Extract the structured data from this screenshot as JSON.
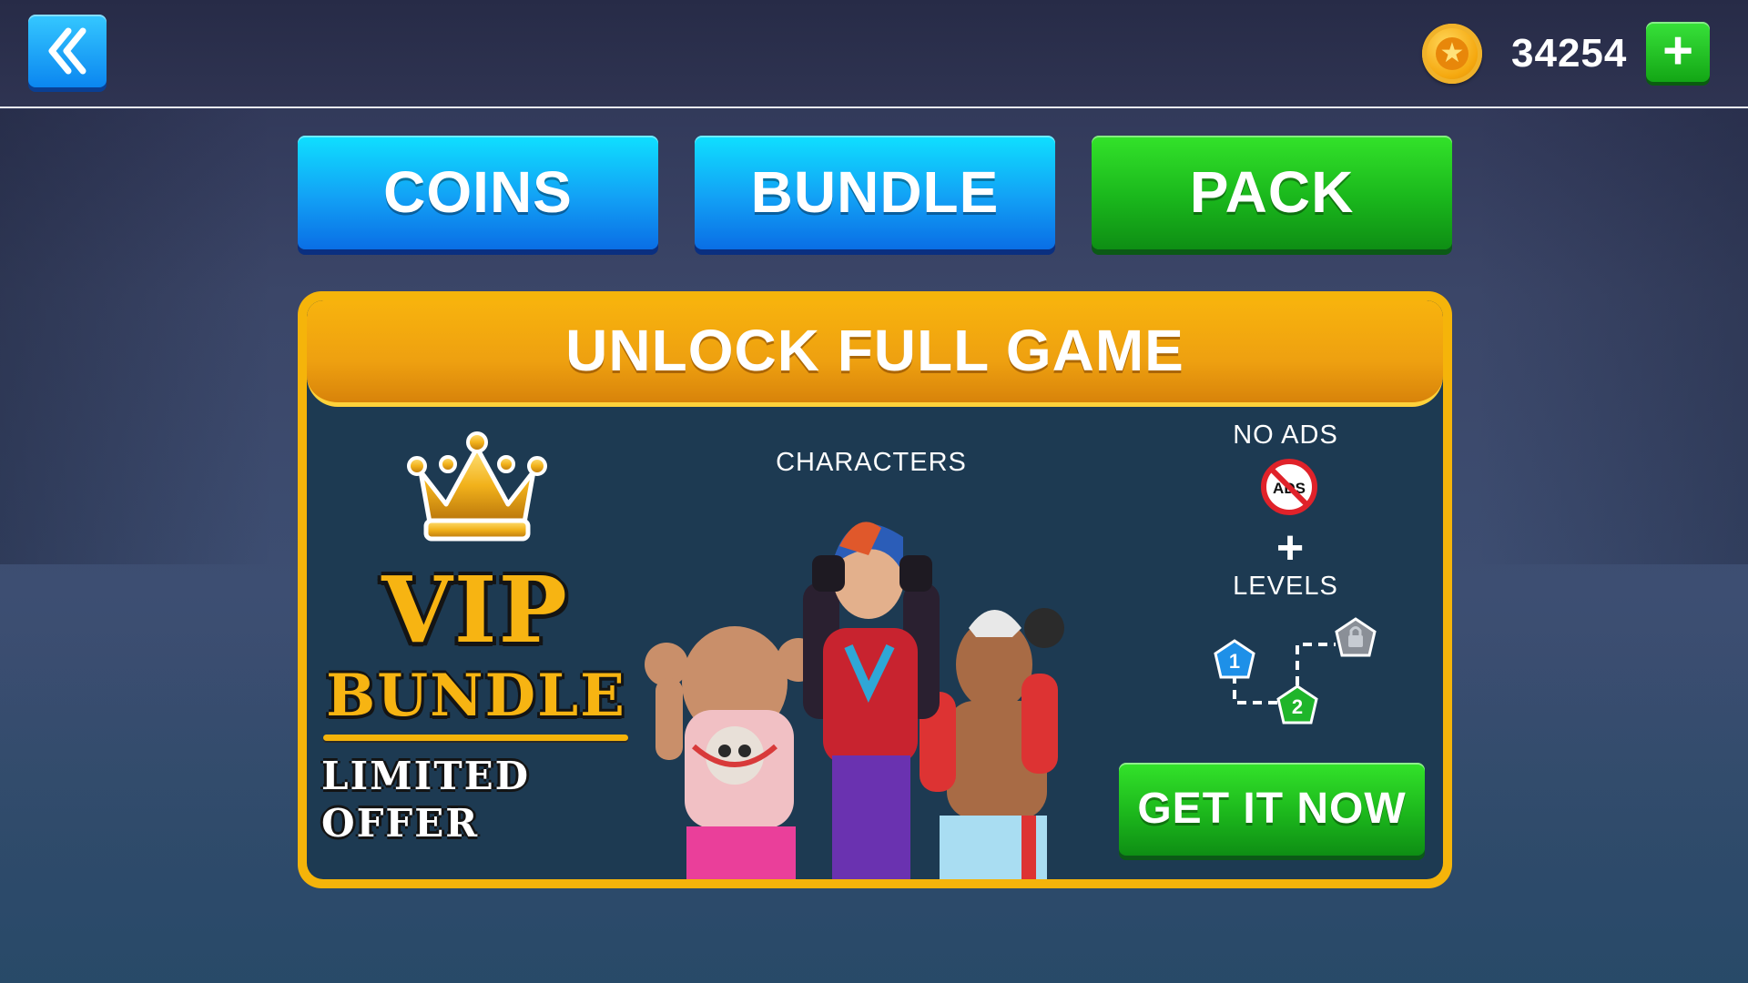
{
  "header": {
    "back_icon": "chevron-double-left-icon",
    "coin_icon": "gold-coin-star-icon",
    "coin_balance": "34254",
    "add_coins_icon": "plus-icon"
  },
  "tabs": [
    {
      "label": "COINS",
      "color": "#12a0f5",
      "active": false
    },
    {
      "label": "BUNDLE",
      "color": "#12a0f5",
      "active": false
    },
    {
      "label": "PACK",
      "color": "#1ab71c",
      "active": true
    }
  ],
  "offer": {
    "title": "UNLOCK FULL GAME",
    "vip_line1": "VIP",
    "vip_line2": "BUNDLE",
    "limited_line1": "LIMITED",
    "limited_line2": "OFFER",
    "characters_label": "CHARACTERS",
    "no_ads_label": "NO ADS",
    "no_ads_icon_text": "ADS",
    "plus": "+",
    "levels_label": "LEVELS",
    "level_nodes": [
      "1",
      "2"
    ],
    "cta_label": "GET IT NOW"
  },
  "colors": {
    "accent_gold": "#f5b40a",
    "panel_bg": "#1d3a52",
    "blue_button": "#12a0f5",
    "green_button": "#1ab71c"
  }
}
